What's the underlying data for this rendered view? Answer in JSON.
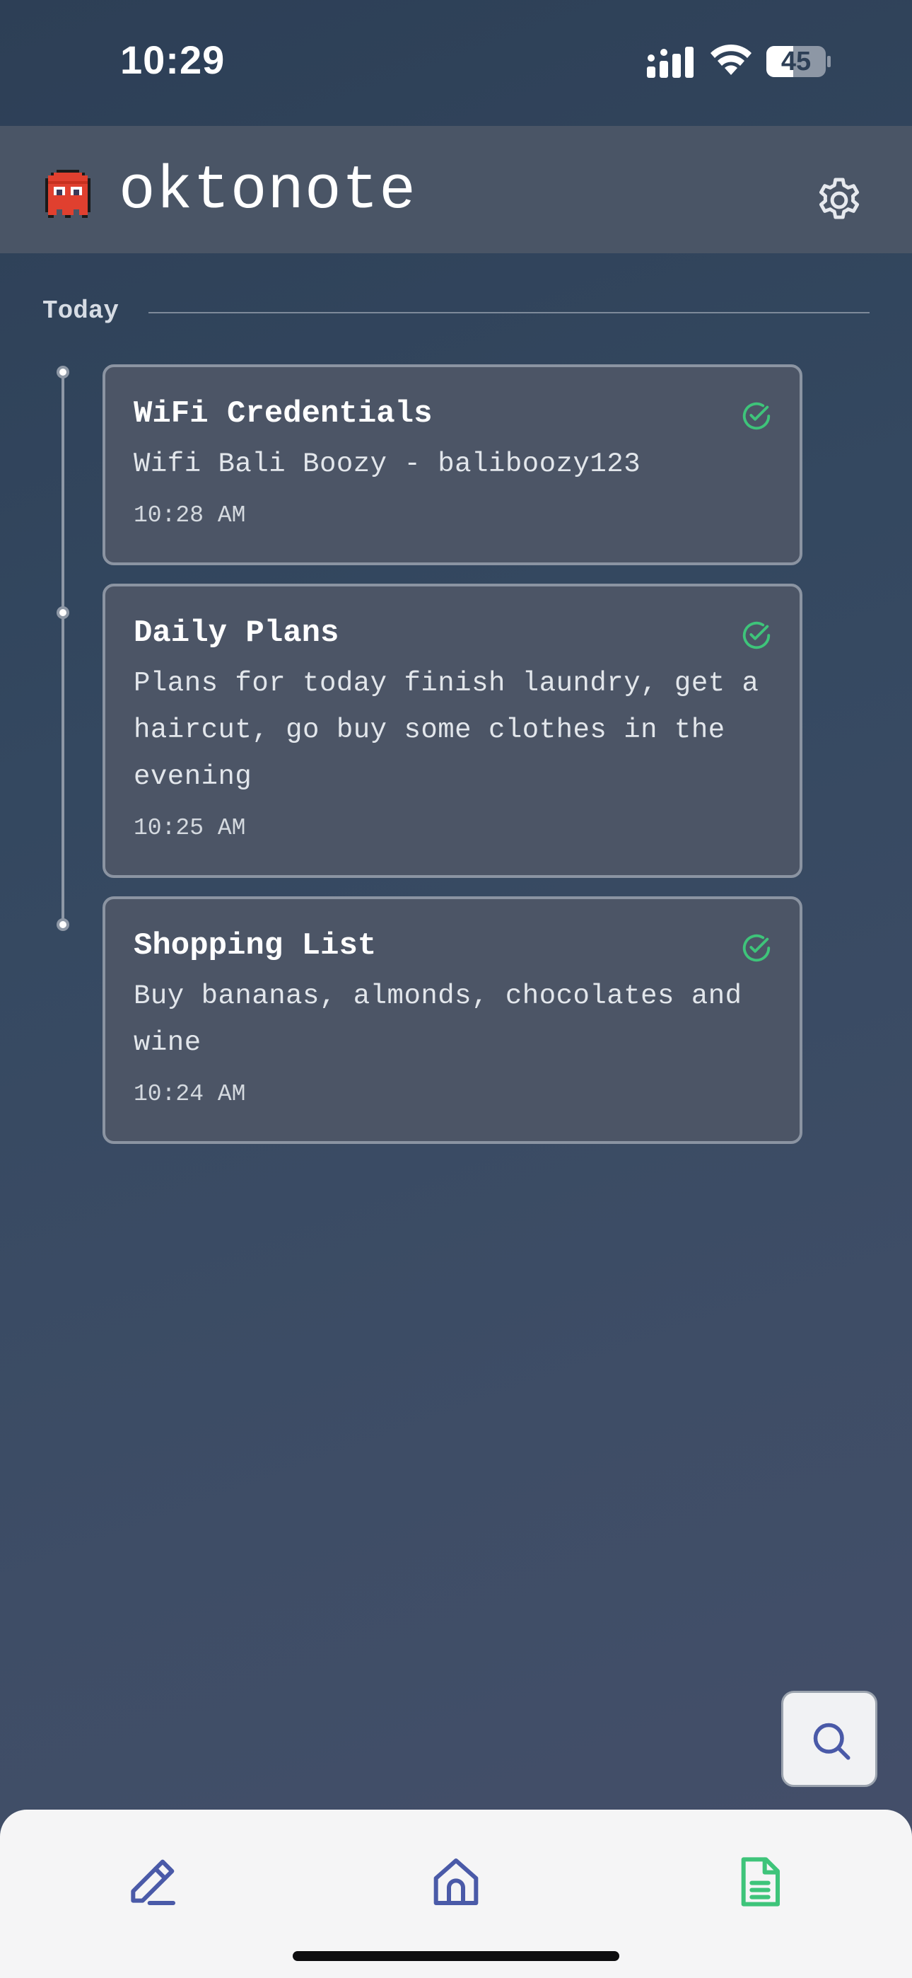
{
  "status_bar": {
    "time": "10:29",
    "battery": "45"
  },
  "header": {
    "title": "oktonote",
    "logo_icon": "ghost-pixel-icon",
    "settings_icon": "gear-icon"
  },
  "section": {
    "label": "Today"
  },
  "notes": [
    {
      "title": "WiFi Credentials",
      "body": "Wifi Bali Boozy - baliboozy123",
      "time": "10:28 AM",
      "status_icon": "check-circle-icon"
    },
    {
      "title": "Daily Plans",
      "body": "Plans for today finish laundry, get a haircut, go buy some clothes in the evening",
      "time": "10:25 AM",
      "status_icon": "check-circle-icon"
    },
    {
      "title": "Shopping List",
      "body": "Buy bananas, almonds, chocolates and wine",
      "time": "10:24 AM",
      "status_icon": "check-circle-icon"
    }
  ],
  "bottom_nav": {
    "items": [
      {
        "icon": "pencil-icon",
        "active": false
      },
      {
        "icon": "home-icon",
        "active": false
      },
      {
        "icon": "document-icon",
        "active": true
      }
    ]
  },
  "search_button": {
    "icon": "search-icon"
  },
  "colors": {
    "accent_green": "#3ec47a",
    "nav_blue": "#4a5aa8",
    "header_bg": "#4a5566",
    "card_bg": "#4c5566"
  }
}
